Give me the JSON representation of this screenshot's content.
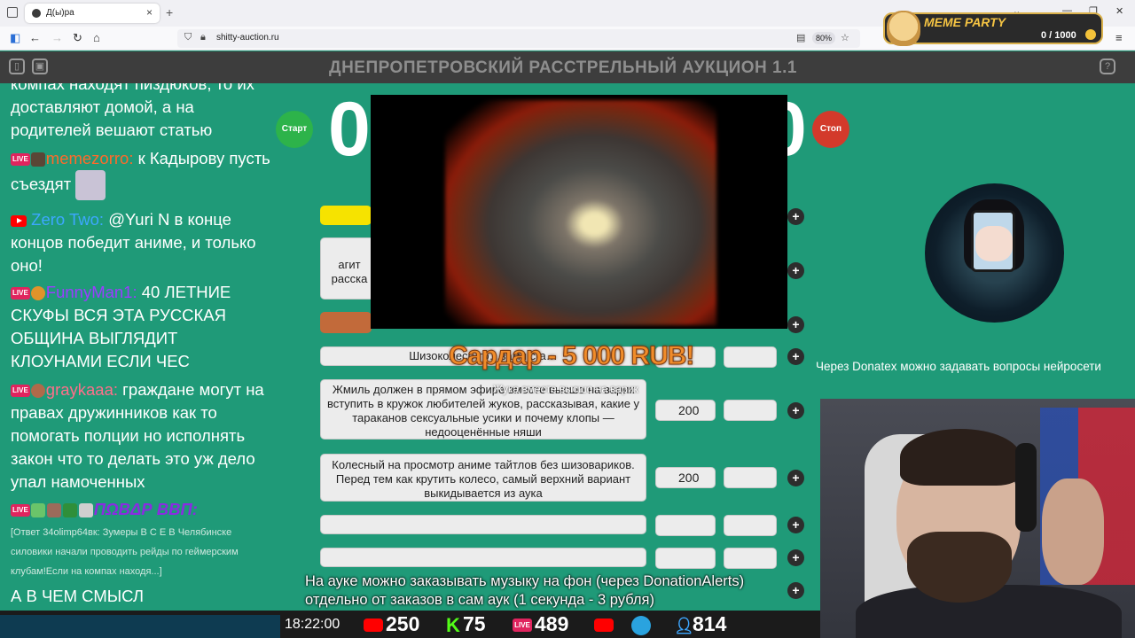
{
  "browser": {
    "tab_title": "Д(ы)ра",
    "tab_close": "×",
    "new_tab": "+",
    "url": "shitty-auction.ru",
    "zoom": "80%",
    "win_minimize": "—",
    "win_restore": "❐",
    "win_close": "✕",
    "chevron": "⌄"
  },
  "meme_party": {
    "title": "MEME PARTY",
    "score": "0 / 1000"
  },
  "header": {
    "title": "ДНЕПРОПЕТРОВСКИЙ РАССТРЕЛЬНЫЙ АУКЦИОН 1.1",
    "help": "?"
  },
  "chat": {
    "messages": [
      {
        "text": "компах находят пиздюков, то их доставляют домой, а на родителей вешают статью"
      },
      {
        "platform": "LIVE",
        "user": "memezorro:",
        "text": " к Кадырову пусть съездят"
      },
      {
        "platform": "youtube",
        "user": "Zero Two:",
        "text": " @Yuri N в конце концов победит аниме, и только оно!"
      },
      {
        "platform": "LIVE",
        "user": "FunnyMan1:",
        "text": " 40 ЛЕТНИЕ СКУФЫ ВСЯ ЭТА РУССКАЯ ОБЩИНА ВЫГЛЯДИТ КЛОУНАМИ ЕСЛИ ЧЕС"
      },
      {
        "platform": "LIVE",
        "user": "graykaaa:",
        "text": " граждане могут на правах дружинников как то помогать полции но исполнять закон что то делать это уж дело упал намоченных"
      },
      {
        "platform": "LIVE",
        "user": "ПΩВΔΡ ΒΒΠ:",
        "text": ""
      },
      {
        "text": "[Ответ 34olimp64вк: Зумеры В С Е В Челябинске силовики начали проводить рейды по геймерским клубам!Если на компах находя...]"
      },
      {
        "text": "А В ЧЕМ СМЫСЛ"
      }
    ]
  },
  "controls": {
    "start": "Старт",
    "stop": "Стоп",
    "timer_left": "0",
    "timer_right": "0"
  },
  "lots": [
    {
      "text": "агит\nрасска",
      "price": "",
      "bid": ""
    },
    {
      "text": "Шизоколесо то…зами сга…",
      "price": "",
      "bid": ""
    },
    {
      "text": "Жмиль должен в прямом эфире вместе высшо на варик вступить в кружок любителей жуков, рассказывая, какие у тараканов сексуальные усики и почему клопы — недооценённые няши",
      "price": "200",
      "bid": ""
    },
    {
      "text": "Колесный на просмотр аниме тайтлов без шизовариков. Перед тем как крутить колесо, самый верхний вариант выкидывается из аука",
      "price": "200",
      "bid": ""
    },
    {
      "text": "",
      "price": "",
      "bid": ""
    },
    {
      "text": "",
      "price": "",
      "bid": ""
    }
  ],
  "plus_label": "+",
  "donation": {
    "alert": "Сардар - 5 000 RUB!",
    "subtext": "Жука вместе высшо на варик"
  },
  "donatex_note": "Через Donatex можно задавать вопросы нейросети",
  "ticker": {
    "line1": "На ауке можно заказывать музыку на фон (через DonationAlerts)",
    "line2": "отдельно от заказов в сам аук (1 секунда - 3 рубля)"
  },
  "stats": {
    "time": "18:22:00",
    "youtube": "250",
    "kick": "75",
    "vk": "489",
    "telegram": "",
    "total": "814"
  },
  "colors": {
    "background": "#1f9a78",
    "header": "#3d3d3d",
    "start": "#2db34a",
    "stop": "#d33a2b",
    "donation": "#f08c2a"
  }
}
